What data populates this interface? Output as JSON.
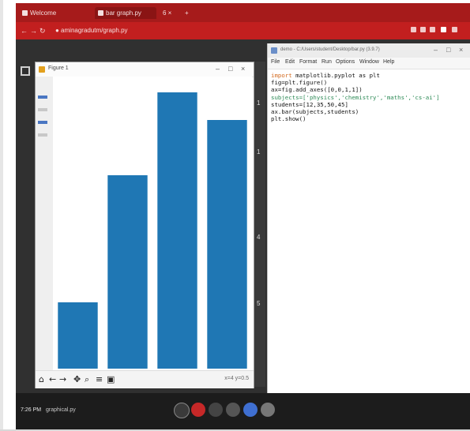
{
  "browser": {
    "tabs": [
      {
        "label": "Welcome"
      },
      {
        "label": "bar graph.py"
      },
      {
        "label": "6 ×"
      }
    ],
    "new_tab": "+",
    "url": "● aminagradutm/graph.py",
    "colors": {
      "tabbar": "#a61b1b",
      "addressbar": "#c21f1f"
    }
  },
  "figure_window": {
    "title": "Figure 1",
    "window_controls": [
      "–",
      "□",
      "×"
    ],
    "toolbar_icons": [
      "home-icon",
      "back-icon",
      "forward-icon",
      "pan-icon",
      "zoom-icon",
      "configure-icon",
      "save-icon"
    ],
    "coords": "x=4 y=0.5"
  },
  "editor": {
    "title": "demo - C:/Users/student/Desktop/bar.py (3.9.7)",
    "menu": [
      "File",
      "Edit",
      "Format",
      "Run",
      "Options",
      "Window",
      "Help"
    ],
    "code": [
      "import matplotlib.pyplot as plt",
      "fig=plt.figure()",
      "ax=fig.add_axes([0,0,1,1])",
      "subjects=['physics','chemistry','maths','cs-ai']",
      "students=[12,35,50,45]",
      "ax.bar(subjects,students)",
      "plt.show()"
    ]
  },
  "strip_numbers": [
    "1",
    "1",
    "4",
    "5"
  ],
  "taskbar": {
    "clock": "7:26 PM",
    "file": "graphical.py"
  },
  "chart_data": {
    "type": "bar",
    "categories": [
      "physics",
      "chemistry",
      "maths",
      "cs-ai"
    ],
    "values": [
      12,
      35,
      50,
      45
    ],
    "ylim": [
      0,
      52
    ],
    "bar_color": "#1f77b4"
  }
}
